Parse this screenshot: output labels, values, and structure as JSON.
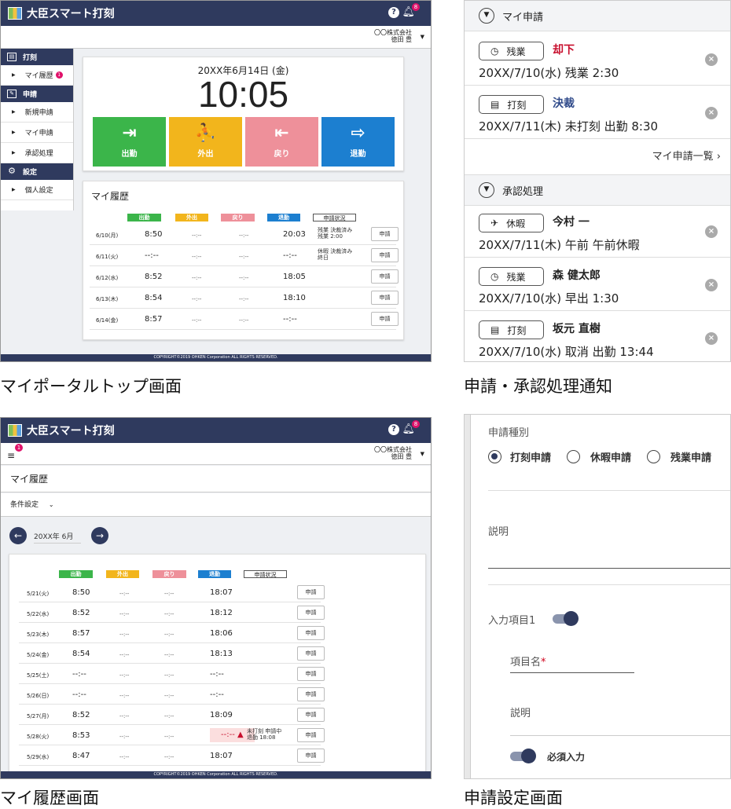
{
  "app": {
    "title": "大臣スマート打刻",
    "help": "?",
    "bell_badge": "8",
    "company": "〇〇株式会社",
    "user": "徳田 豊"
  },
  "portal": {
    "caption": "マイポータルトップ画面",
    "sidebar": [
      {
        "type": "head",
        "label": "打刻",
        "icon": "clock-icon"
      },
      {
        "type": "item",
        "label": "マイ履歴",
        "badge": "1"
      },
      {
        "type": "head",
        "label": "申請",
        "icon": "edit-icon"
      },
      {
        "type": "item",
        "label": "新規申請"
      },
      {
        "type": "item",
        "label": "マイ申請"
      },
      {
        "type": "item",
        "label": "承認処理"
      },
      {
        "type": "head",
        "label": "設定",
        "icon": "gear-icon"
      },
      {
        "type": "item",
        "label": "個人設定"
      }
    ],
    "date": "20XX年6月14日 (金)",
    "time": "10:05",
    "buttons": [
      {
        "label": "出勤",
        "icon": "clock-in-icon",
        "glyph": "⇥",
        "color": "#3bb54a"
      },
      {
        "label": "外出",
        "icon": "go-out-icon",
        "glyph": "⛹",
        "color": "#f2b51c"
      },
      {
        "label": "戻り",
        "icon": "return-icon",
        "glyph": "⇤",
        "color": "#ee909a"
      },
      {
        "label": "退勤",
        "icon": "clock-out-icon",
        "glyph": "⇨",
        "color": "#1c7fd0"
      }
    ],
    "history_title": "マイ履歴",
    "headers": {
      "in": "出勤",
      "out": "外出",
      "back": "戻り",
      "leave": "退勤",
      "status": "申請状況"
    },
    "rows": [
      {
        "d": "6/10(月)",
        "in": "8:50",
        "out": "--:--",
        "back": "--:--",
        "leave": "20:03",
        "status": "残業 決裁済み\n残業 2:00",
        "btn": "申請"
      },
      {
        "d": "6/11(火)",
        "in": "--:--",
        "out": "--:--",
        "back": "--:--",
        "leave": "--:--",
        "status": "休暇 決裁済み\n終日",
        "btn": "申請"
      },
      {
        "d": "6/12(水)",
        "in": "8:52",
        "out": "--:--",
        "back": "--:--",
        "leave": "18:05",
        "status": "",
        "btn": "申請"
      },
      {
        "d": "6/13(木)",
        "in": "8:54",
        "out": "--:--",
        "back": "--:--",
        "leave": "18:10",
        "status": "",
        "btn": "申請"
      },
      {
        "d": "6/14(金)",
        "in": "8:57",
        "out": "--:--",
        "back": "--:--",
        "leave": "--:--",
        "status": "",
        "btn": "申請"
      }
    ],
    "footer": "COPYRIGHT©2019 OHKEN Corporation ALL RIGHTS RESERVED."
  },
  "notify": {
    "caption": "申請・承認処理通知",
    "my_section": "マイ申請",
    "my_items": [
      {
        "type": "残業",
        "icon": "clock-icon",
        "glyph": "◷",
        "who": "却下",
        "who_color": "#c8102e",
        "text": "20XX/7/10(水) 残業 2:30"
      },
      {
        "type": "打刻",
        "icon": "document-icon",
        "glyph": "▤",
        "who": "決裁",
        "who_color": "#2f4a8a",
        "text": "20XX/7/11(木) 未打刻 出勤 8:30"
      }
    ],
    "my_link": "マイ申請一覧 ›",
    "approve_section": "承認処理",
    "approve_items": [
      {
        "type": "休暇",
        "icon": "airplane-icon",
        "glyph": "✈",
        "who": "今村 一",
        "who_color": "#222",
        "text": "20XX/7/11(木) 午前 午前休暇"
      },
      {
        "type": "残業",
        "icon": "clock-icon",
        "glyph": "◷",
        "who": "森 健太郎",
        "who_color": "#222",
        "text": "20XX/7/10(水) 早出 1:30"
      },
      {
        "type": "打刻",
        "icon": "document-icon",
        "glyph": "▤",
        "who": "坂元 直樹",
        "who_color": "#222",
        "text": "20XX/7/10(水) 取消 出勤 13:44"
      }
    ]
  },
  "history": {
    "caption": "マイ履歴画面",
    "menu_badge": "1",
    "page_title": "マイ履歴",
    "cond": "条件設定",
    "month": "20XX年 6月",
    "rows": [
      {
        "d": "5/21(火)",
        "in": "8:50",
        "out": "--:--",
        "back": "--:--",
        "leave": "18:07",
        "status": "",
        "btn": "申請"
      },
      {
        "d": "5/22(水)",
        "in": "8:52",
        "out": "--:--",
        "back": "--:--",
        "leave": "18:12",
        "status": "",
        "btn": "申請"
      },
      {
        "d": "5/23(木)",
        "in": "8:57",
        "out": "--:--",
        "back": "--:--",
        "leave": "18:06",
        "status": "",
        "btn": "申請"
      },
      {
        "d": "5/24(金)",
        "in": "8:54",
        "out": "--:--",
        "back": "--:--",
        "leave": "18:13",
        "status": "",
        "btn": "申請"
      },
      {
        "d": "5/25(土)",
        "in": "--:--",
        "out": "--:--",
        "back": "--:--",
        "leave": "--:--",
        "status": "",
        "btn": "申請"
      },
      {
        "d": "5/26(日)",
        "in": "--:--",
        "out": "--:--",
        "back": "--:--",
        "leave": "--:--",
        "status": "",
        "btn": "申請"
      },
      {
        "d": "5/27(月)",
        "in": "8:52",
        "out": "--:--",
        "back": "--:--",
        "leave": "18:09",
        "status": "",
        "btn": "申請"
      },
      {
        "d": "5/28(火)",
        "in": "8:53",
        "out": "--:--",
        "back": "--:--",
        "leave": "--:-- ▲",
        "status": "未打刻 申請中\n退勤 18:08",
        "btn": "申請",
        "warn": true
      },
      {
        "d": "5/29(水)",
        "in": "8:47",
        "out": "--:--",
        "back": "--:--",
        "leave": "18:07",
        "status": "",
        "btn": "申請"
      }
    ]
  },
  "settings": {
    "caption": "申請設定画面",
    "type_label": "申請種別",
    "radios": [
      "打刻申請",
      "休暇申請",
      "残業申請"
    ],
    "desc_label": "説明",
    "input1_label": "入力項目1",
    "item_name_label": "項目名",
    "required_mark": "*",
    "desc2_label": "説明",
    "required_label": "必須入力"
  }
}
